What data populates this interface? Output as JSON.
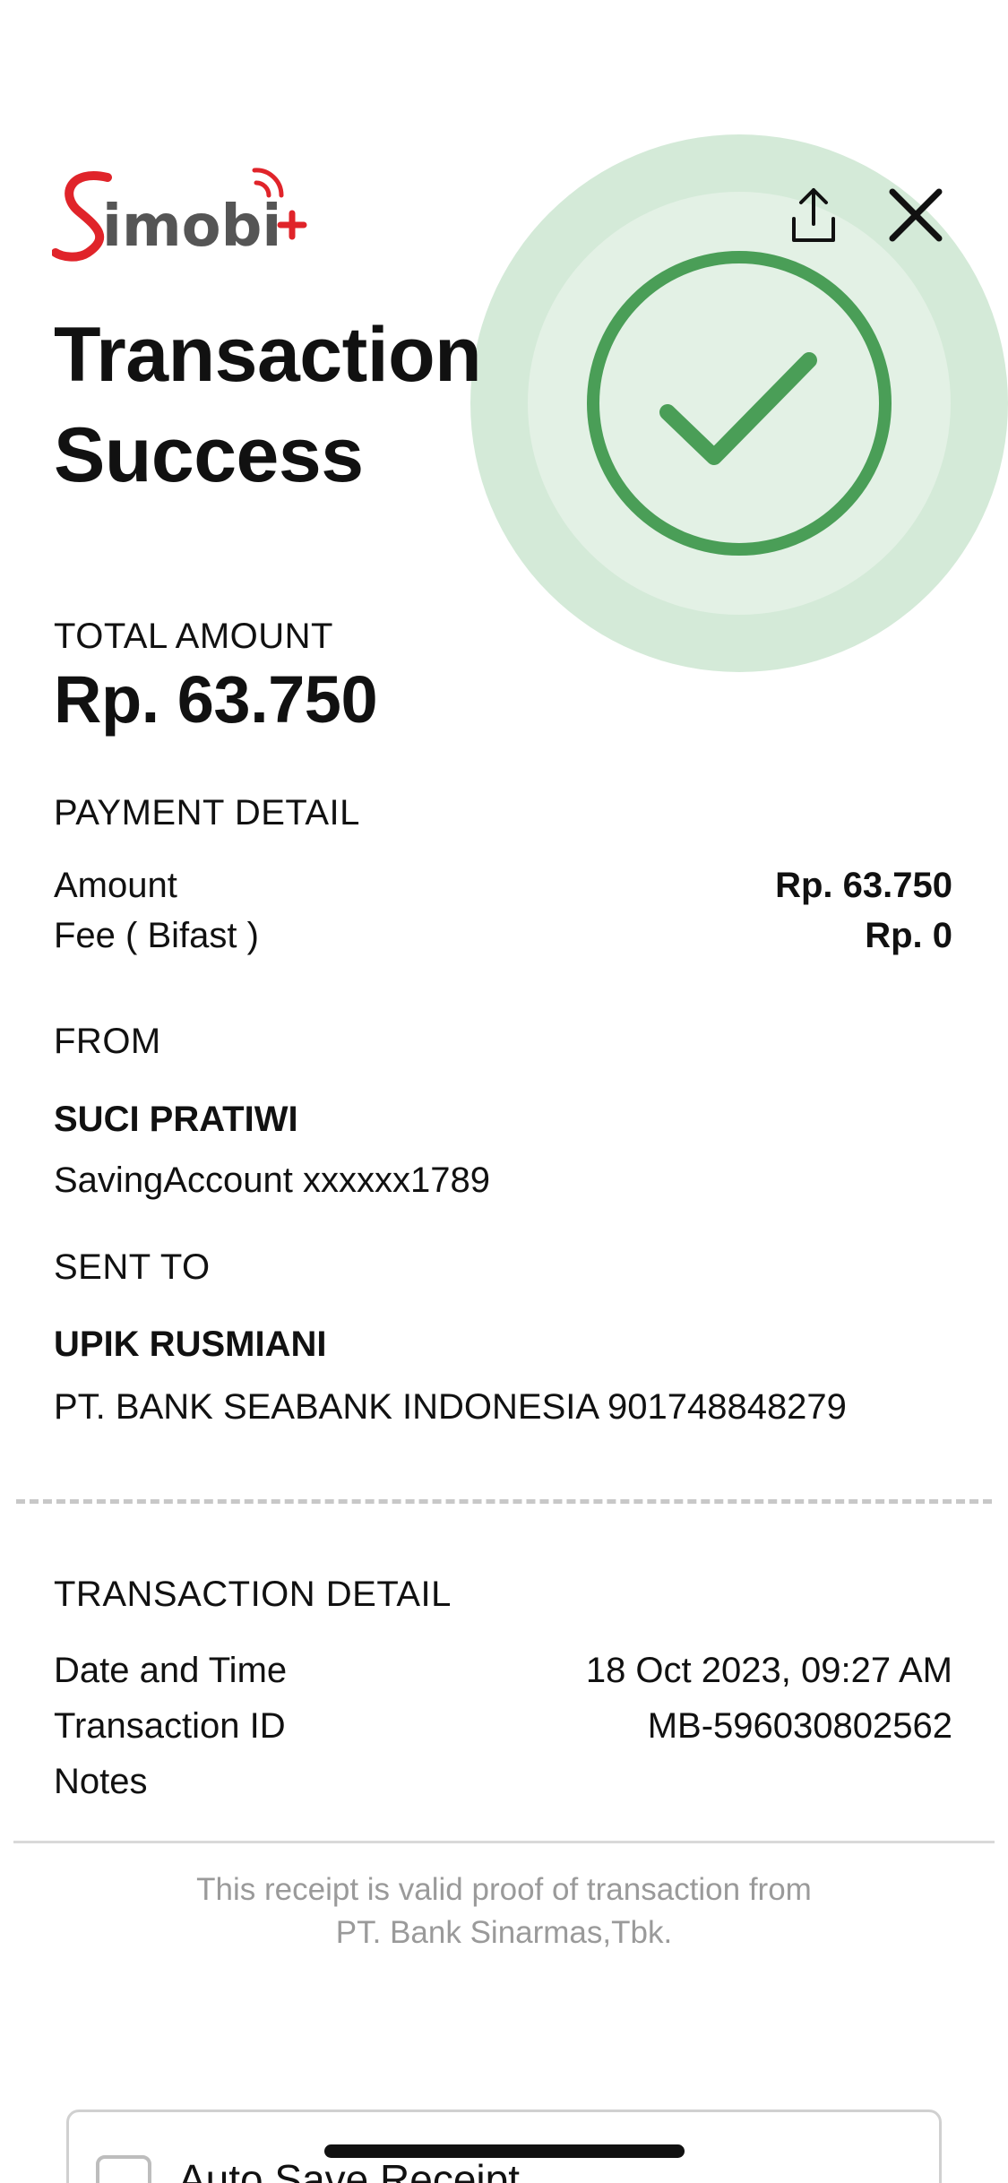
{
  "brand": {
    "logo_text": "Simobi+"
  },
  "header": {
    "title_line1": "Transaction",
    "title_line2": "Success",
    "share_icon": "share-icon",
    "close_icon": "close-icon"
  },
  "status": {
    "icon": "check-icon",
    "color": "#4a9e57",
    "halo_outer": "#d4ead8",
    "halo_inner": "#e3f1e5"
  },
  "total": {
    "label": "TOTAL AMOUNT",
    "value": "Rp. 63.750"
  },
  "payment": {
    "label": "PAYMENT DETAIL",
    "rows": [
      {
        "key": "Amount",
        "value": "Rp. 63.750"
      },
      {
        "key": "Fee ( Bifast )",
        "value": "Rp. 0"
      }
    ]
  },
  "from": {
    "label": "FROM",
    "name": "SUCI PRATIWI",
    "account": "SavingAccount xxxxxx1789"
  },
  "sent_to": {
    "label": "SENT TO",
    "name": "UPIK RUSMIANI",
    "account": "PT. BANK SEABANK INDONESIA 901748848279"
  },
  "transaction": {
    "label": "TRANSACTION DETAIL",
    "rows": [
      {
        "key": "Date and Time",
        "value": "18 Oct 2023, 09:27 AM"
      },
      {
        "key": "Transaction ID",
        "value": "MB-596030802562"
      },
      {
        "key": "Notes",
        "value": ""
      }
    ]
  },
  "footer": {
    "note_line1": "This receipt is valid proof of transaction from",
    "note_line2": "PT. Bank Sinarmas,Tbk."
  },
  "auto_save": {
    "label": "Auto Save Receipt",
    "checked": false
  }
}
